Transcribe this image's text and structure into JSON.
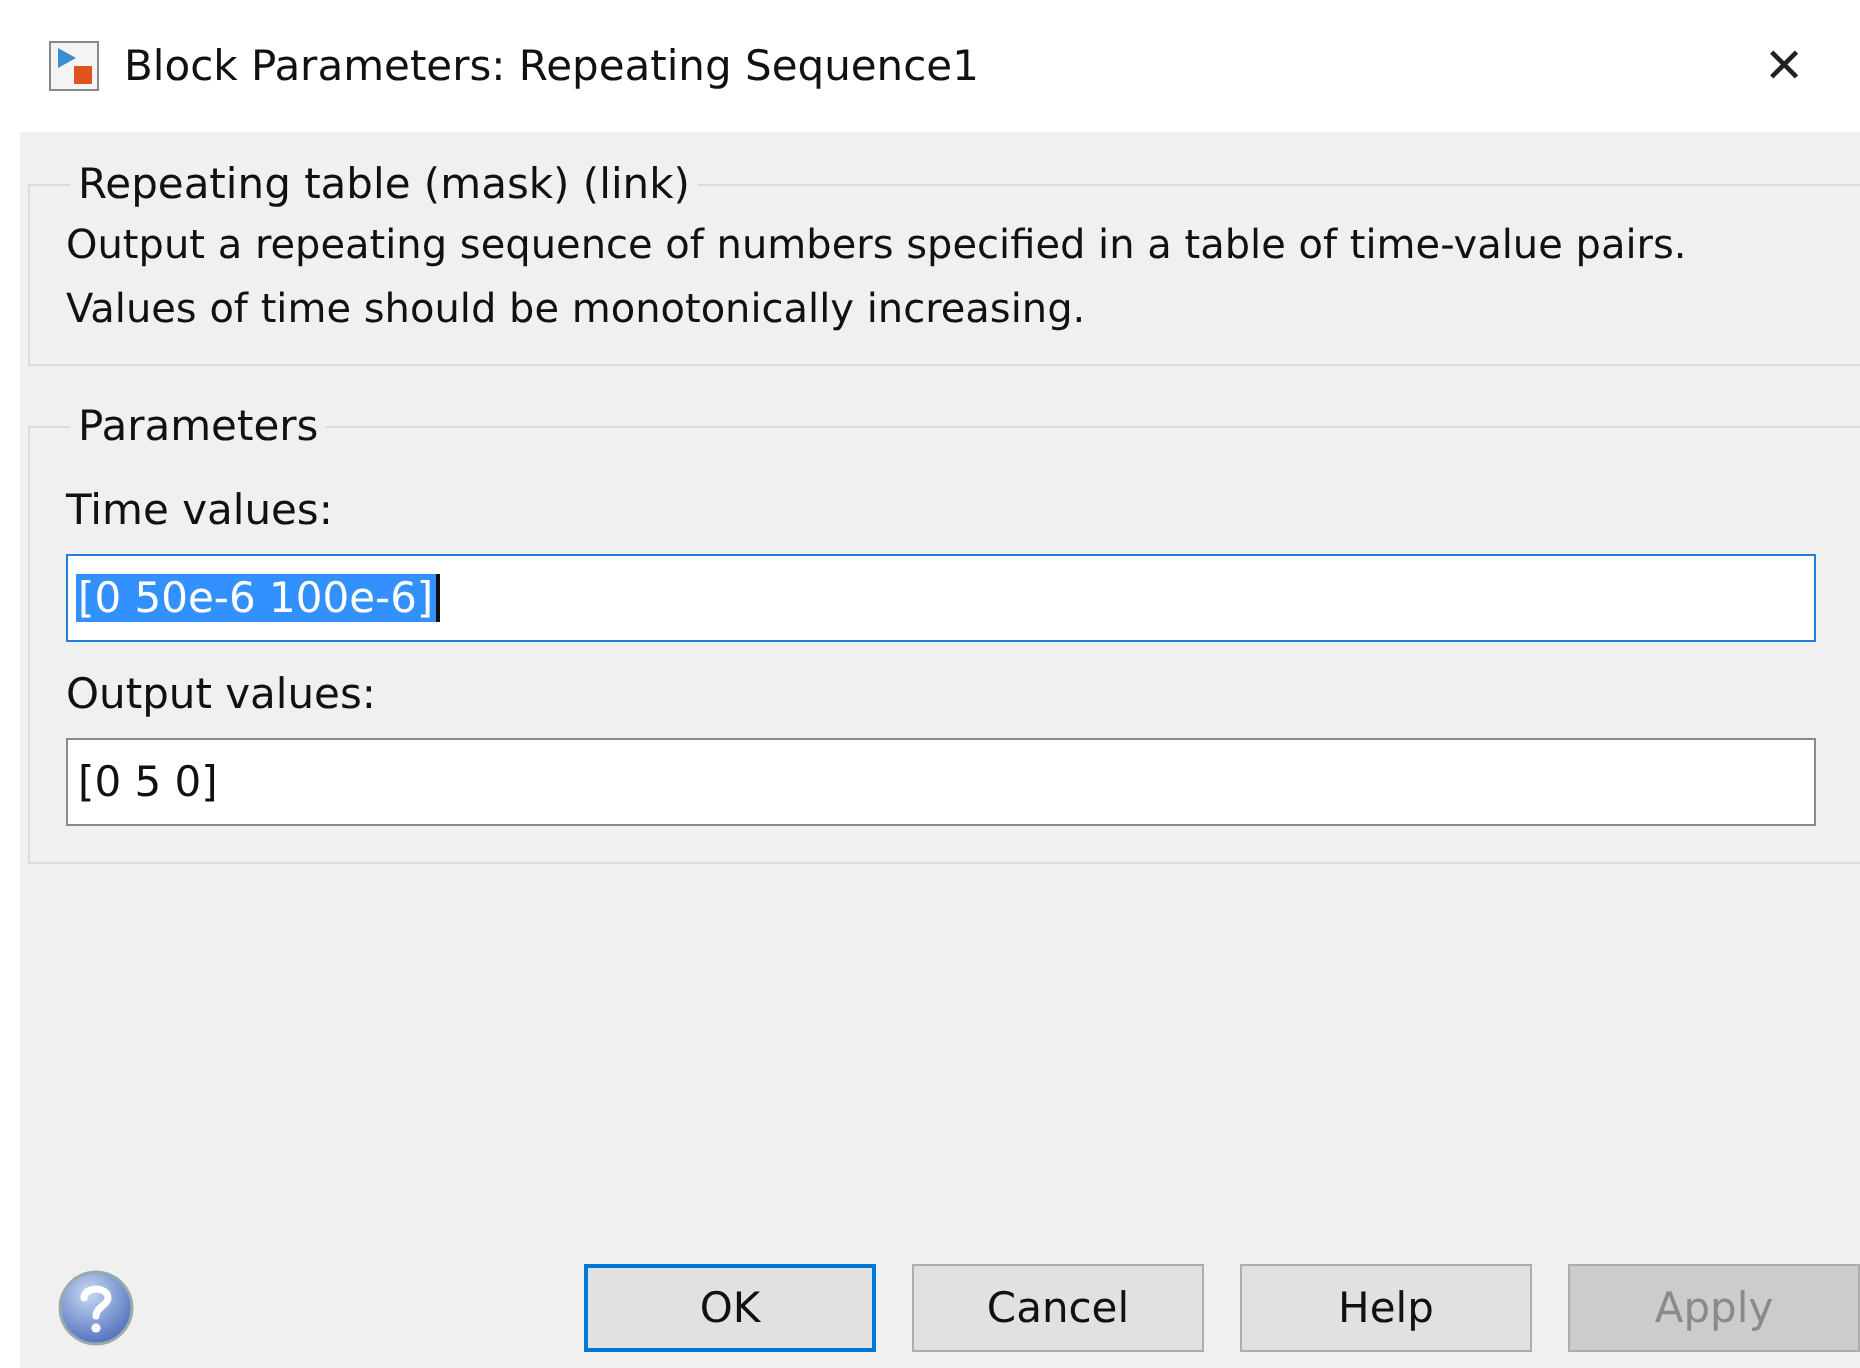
{
  "window": {
    "title": "Block Parameters: Repeating Sequence1",
    "close": "✕"
  },
  "description_group": {
    "legend": "Repeating table (mask) (link)",
    "text": "Output a repeating sequence of numbers specified in a table of time-value pairs. Values of time should be monotonically increasing."
  },
  "parameters_group": {
    "legend": "Parameters",
    "fields": [
      {
        "label": "Time values:",
        "value": "[0 50e-6 100e-6]",
        "focused": true
      },
      {
        "label": "Output values:",
        "value": "[0 5 0]",
        "focused": false
      }
    ]
  },
  "buttons": [
    {
      "label": "OK",
      "default": true,
      "disabled": false
    },
    {
      "label": "Cancel",
      "default": false,
      "disabled": false
    },
    {
      "label": "Help",
      "default": false,
      "disabled": false
    },
    {
      "label": "Apply",
      "default": false,
      "disabled": true
    }
  ]
}
